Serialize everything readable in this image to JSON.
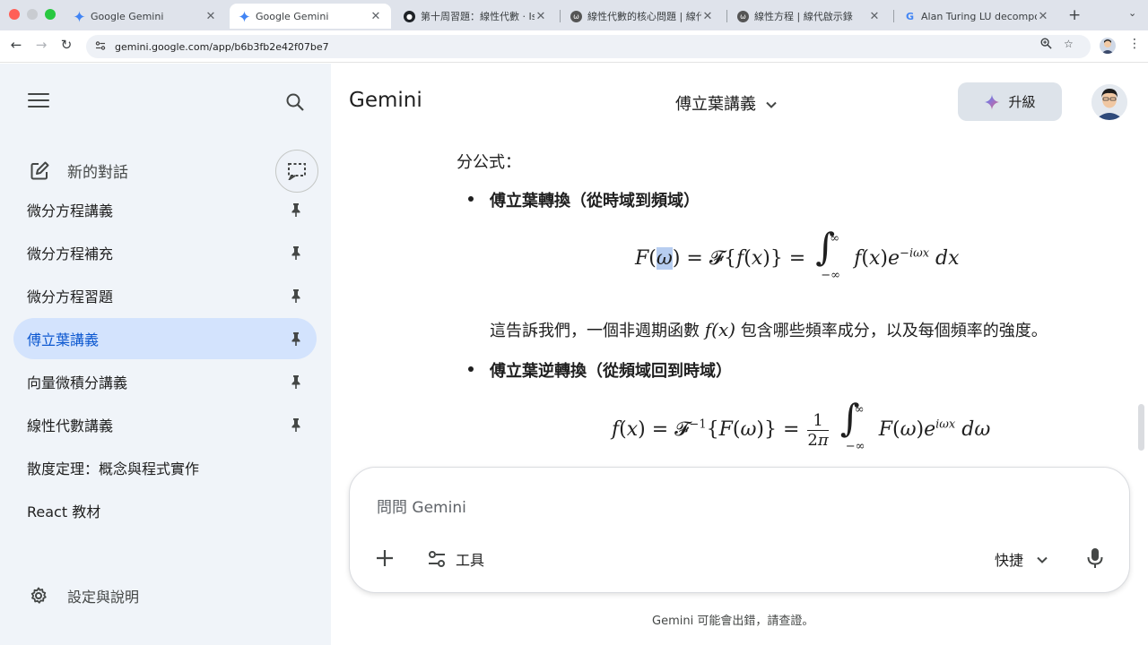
{
  "browser": {
    "tabs": [
      {
        "title": "Google Gemini",
        "favicon": "gemini-icon",
        "active": false
      },
      {
        "title": "Google Gemini",
        "favicon": "gemini-icon",
        "active": true
      },
      {
        "title": "第十周習題：線性代數 · Issue",
        "favicon": "github-icon",
        "active": false
      },
      {
        "title": "線性代數的核心問題 | 線代啟示",
        "favicon": "site-icon",
        "active": false
      },
      {
        "title": "線性方程 | 線代啟示錄",
        "favicon": "site-icon",
        "active": false
      },
      {
        "title": "Alan Turing LU decompositio",
        "favicon": "google-icon",
        "active": false
      }
    ],
    "url": "gemini.google.com/app/b6b3fb2e42f07be7"
  },
  "sidebar": {
    "new_chat": "新的對話",
    "items": [
      {
        "label": "微分方程講義",
        "pinned": true,
        "active": false
      },
      {
        "label": "微分方程補充",
        "pinned": true,
        "active": false
      },
      {
        "label": "微分方程習題",
        "pinned": true,
        "active": false
      },
      {
        "label": "傅立葉講義",
        "pinned": true,
        "active": true
      },
      {
        "label": "向量微積分講義",
        "pinned": true,
        "active": false
      },
      {
        "label": "線性代數講義",
        "pinned": true,
        "active": false
      },
      {
        "label": "散度定理：概念與程式實作",
        "pinned": false,
        "active": false
      },
      {
        "label": "React 教材",
        "pinned": false,
        "active": false
      }
    ],
    "settings": "設定與說明"
  },
  "header": {
    "brand": "Gemini",
    "conversation_title": "傅立葉講義",
    "upgrade": "升級"
  },
  "content": {
    "intro_tail": "分公式：",
    "bullet1": "傅立葉轉換（從時域到頻域）",
    "formula1": "F(ω) = ℱ{f(x)} = ∫_{-∞}^{∞} f(x) e^{-iωx} dx",
    "explain1_before": "這告訴我們，一個非週期函數 ",
    "explain1_math": "f(x)",
    "explain1_after": " 包含哪些頻率成分，以及每個頻率的強度。",
    "bullet2": "傅立葉逆轉換（從頻域回到時域）",
    "formula2": "f(x) = ℱ^{-1}{F(ω)} = 1/(2π) ∫_{-∞}^{∞} F(ω) e^{iωx} dω"
  },
  "input": {
    "placeholder": "問問 Gemini",
    "tools": "工具",
    "model": "快捷"
  },
  "disclaimer": "Gemini 可能會出錯，請查證。"
}
